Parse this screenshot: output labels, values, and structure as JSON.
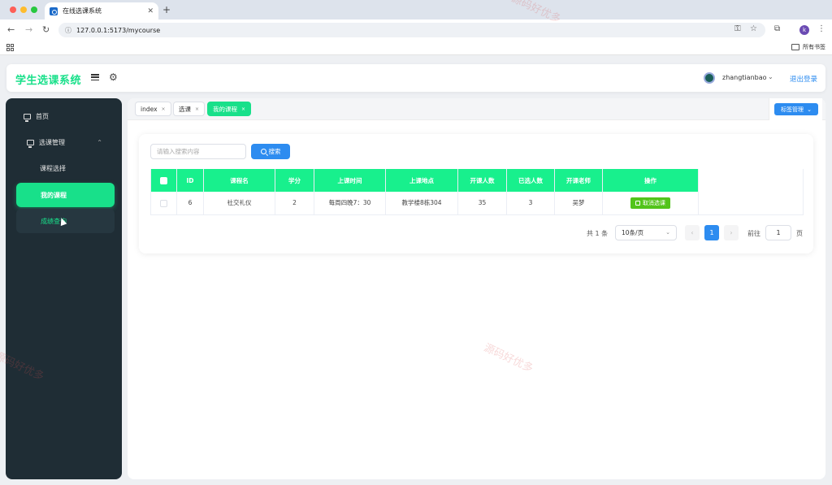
{
  "browser": {
    "tab_title": "在线选课系统",
    "url": "127.0.0.1:5173/mycourse",
    "bookmarks_label": "所有书签",
    "profile_initial": "k"
  },
  "header": {
    "logo": "学生选课系统",
    "username": "zhangtianbao",
    "logout": "退出登录"
  },
  "sidebar": {
    "home": "首页",
    "group": "选课管理",
    "items": [
      "课程选择",
      "我的课程",
      "成绩查询"
    ]
  },
  "tags": [
    "index",
    "选课",
    "我的课程"
  ],
  "tag_manage": "标签管理",
  "search": {
    "placeholder": "请输入搜索内容",
    "button": "搜索"
  },
  "table": {
    "headers": [
      "ID",
      "课程名",
      "学分",
      "上课时间",
      "上课地点",
      "开课人数",
      "已选人数",
      "开课老师",
      "操作"
    ],
    "rows": [
      {
        "id": "6",
        "name": "社交礼仪",
        "credit": "2",
        "time": "每周四晚7：30",
        "place": "教学楼8栋304",
        "capacity": "35",
        "selected": "3",
        "teacher": "吴梦",
        "action": "取消选课"
      }
    ]
  },
  "pagination": {
    "total": "共 1 条",
    "page_size": "10条/页",
    "current_page": "1",
    "goto_label": "前往",
    "goto_value": "1",
    "goto_unit": "页"
  },
  "watermark": "源码好优多",
  "colors": {
    "accent": "#18e08a",
    "primary": "#2d8cf0",
    "sidebar_bg": "#1f2d35",
    "success": "#52c41a"
  }
}
